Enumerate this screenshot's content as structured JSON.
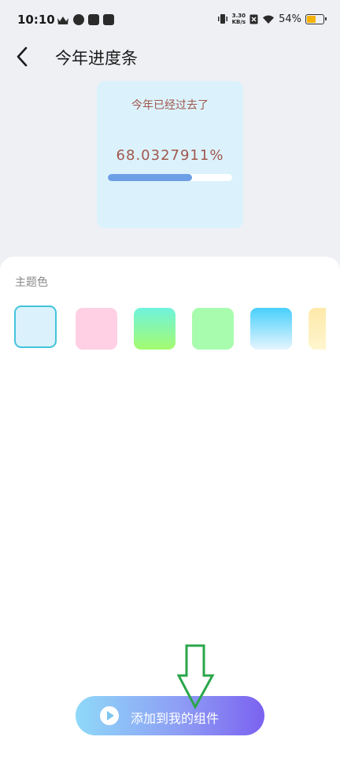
{
  "status_bar": {
    "time": "10:10",
    "speed_value": "3.30",
    "speed_unit": "KB/s",
    "battery": "54%",
    "battery_level": 0.54,
    "icons": [
      "crown-icon",
      "app-icon",
      "tiktok-icon",
      "mail-icon",
      "vibrate-icon",
      "no-sim-icon",
      "wifi-icon",
      "battery-icon"
    ]
  },
  "header": {
    "title": "今年进度条",
    "back_icon": "chevron-left-icon"
  },
  "widget": {
    "label": "今年已经过去了",
    "percent": "68.0327911%",
    "progress": 0.680327911,
    "bg_color": "#dbf2fc",
    "text_color": "#a2574d",
    "bar_color": "#6b9fe6"
  },
  "theme": {
    "label": "主题色",
    "selected_index": 0,
    "swatches": [
      {
        "name": "light-blue",
        "color": "linear-gradient(#dbf2fc,#dbf2fc)"
      },
      {
        "name": "pink",
        "color": "linear-gradient(#ffcfe4,#ffcfe4)"
      },
      {
        "name": "cyan-green",
        "color": "linear-gradient(180deg,#6ff3dd,#a4fb6f)"
      },
      {
        "name": "green",
        "color": "linear-gradient(#a8fcad,#a8fcad)"
      },
      {
        "name": "blue-sky",
        "color": "linear-gradient(180deg,#48cffb,#e6f5ff)"
      },
      {
        "name": "yellow",
        "color": "linear-gradient(180deg,#fde9a9,#fff6cf)"
      }
    ]
  },
  "add_button": {
    "label": "添加到我的组件",
    "icon": "play-icon"
  }
}
